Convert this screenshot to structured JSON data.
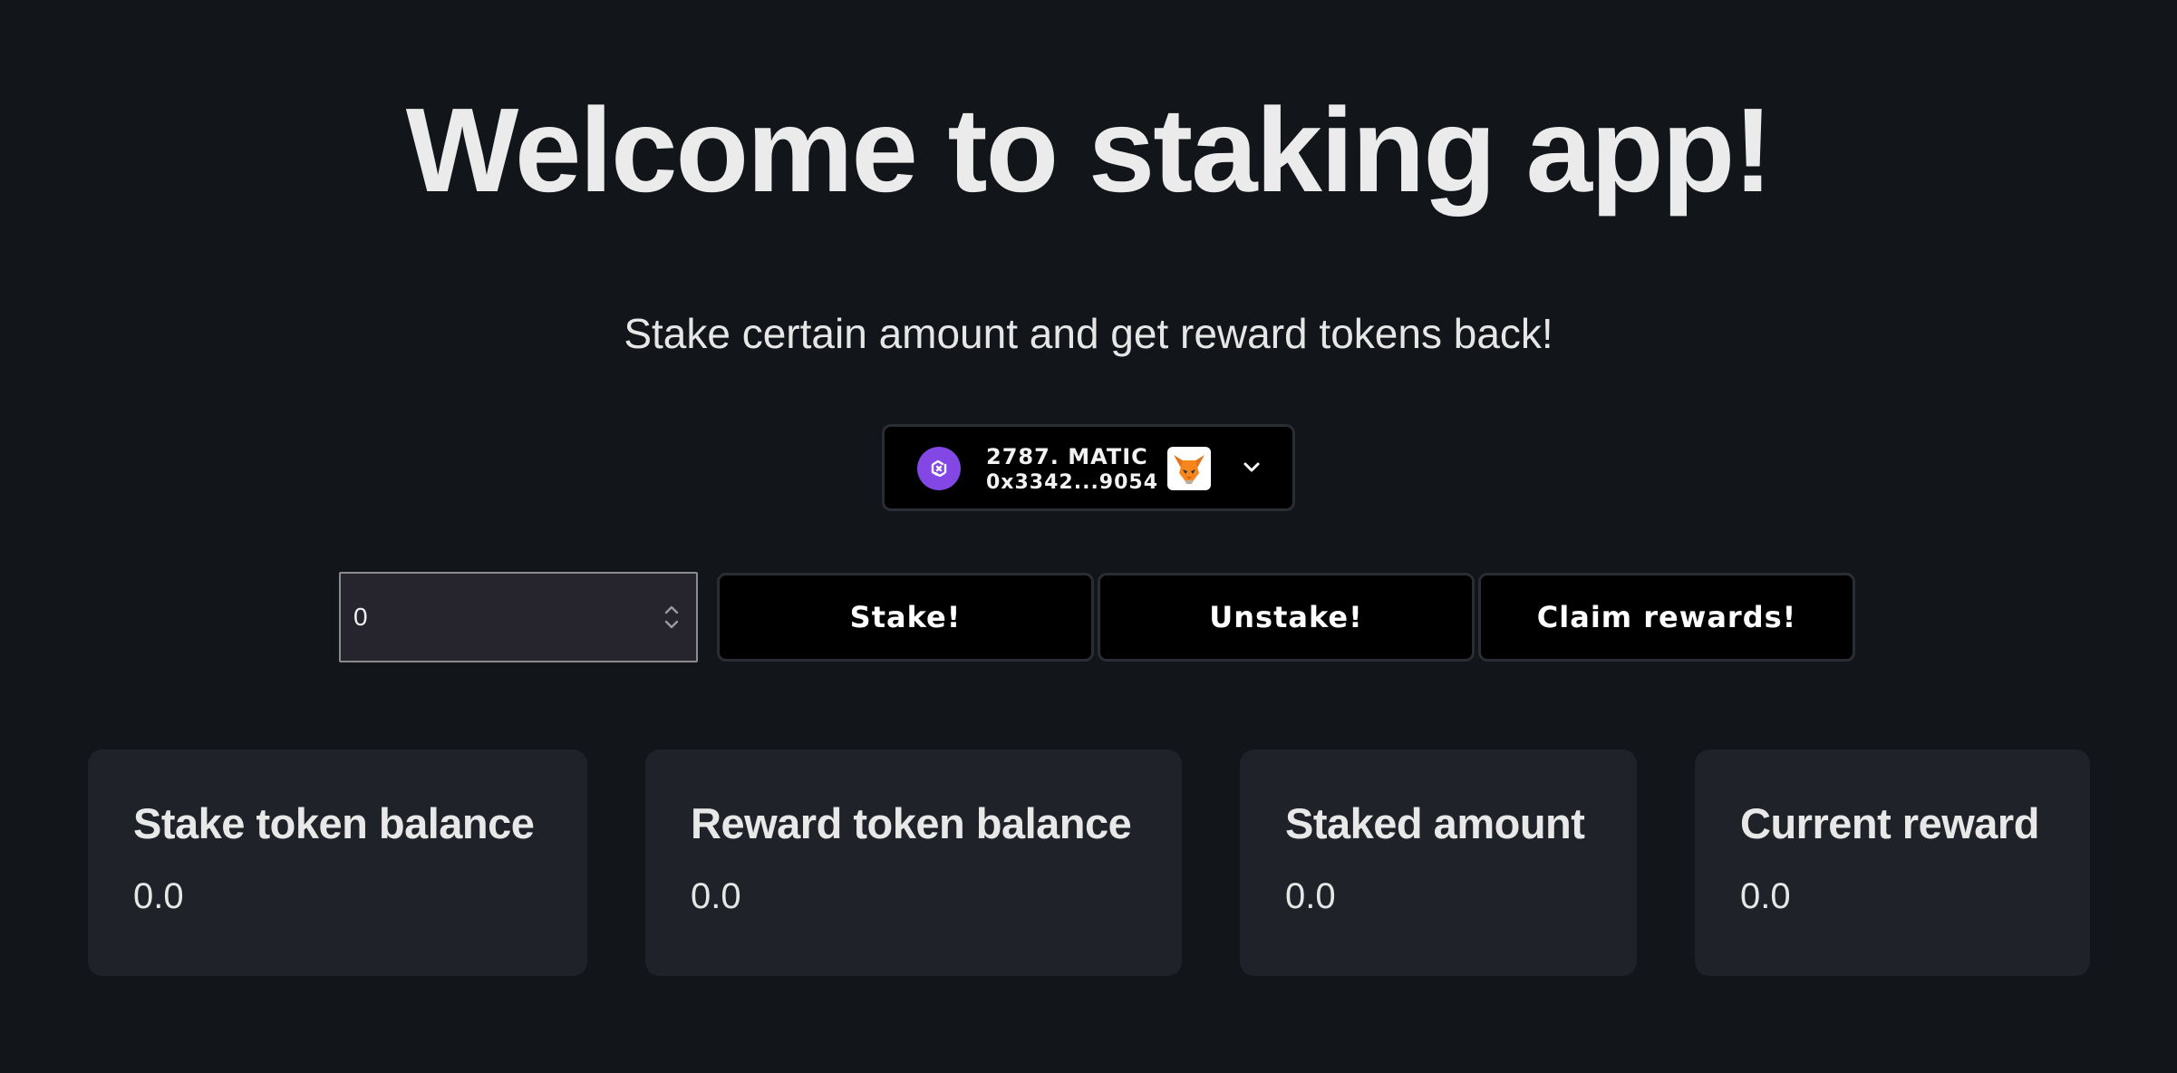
{
  "page": {
    "title": "Welcome to staking app!",
    "subtitle": "Stake certain amount and get reward tokens back!"
  },
  "wallet": {
    "balance": "2787. MATIC",
    "address": "0x3342...9054",
    "chain_icon": "polygon-icon",
    "avatar_icon": "metamask-fox-icon",
    "dropdown_icon": "chevron-down-icon",
    "chain_color": "#8247e5"
  },
  "stake_form": {
    "amount_value": "0",
    "stake_label": "Stake!",
    "unstake_label": "Unstake!",
    "claim_label": "Claim rewards!"
  },
  "stats": [
    {
      "label": "Stake token balance",
      "value": "0.0"
    },
    {
      "label": "Reward token balance",
      "value": "0.0"
    },
    {
      "label": "Staked amount",
      "value": "0.0"
    },
    {
      "label": "Current reward",
      "value": "0.0"
    }
  ]
}
